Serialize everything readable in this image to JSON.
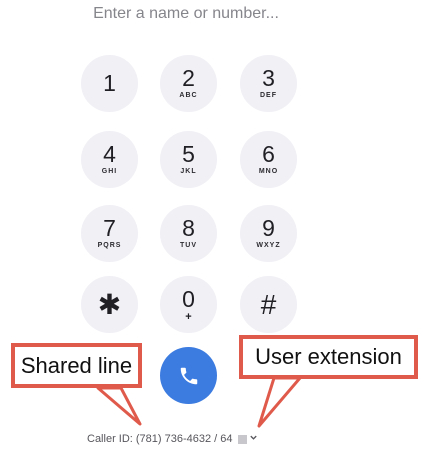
{
  "search": {
    "placeholder": "Enter a name or number..."
  },
  "keypad": {
    "keys": [
      {
        "digit": "1",
        "letters": ""
      },
      {
        "digit": "2",
        "letters": "ABC"
      },
      {
        "digit": "3",
        "letters": "DEF"
      },
      {
        "digit": "4",
        "letters": "GHI"
      },
      {
        "digit": "5",
        "letters": "JKL"
      },
      {
        "digit": "6",
        "letters": "MNO"
      },
      {
        "digit": "7",
        "letters": "PQRS"
      },
      {
        "digit": "8",
        "letters": "TUV"
      },
      {
        "digit": "9",
        "letters": "WXYZ"
      },
      {
        "digit": "✱",
        "letters": ""
      },
      {
        "digit": "0",
        "letters": "+"
      },
      {
        "digit": "#",
        "letters": ""
      }
    ]
  },
  "call_button": {
    "icon": "phone-icon",
    "color": "#3c7be0"
  },
  "caller_id": {
    "text": "Caller ID: (781) 736-4632 / 64"
  },
  "annotations": {
    "shared_line": "Shared line",
    "user_extension": "User extension",
    "color": "#e05a4b"
  }
}
